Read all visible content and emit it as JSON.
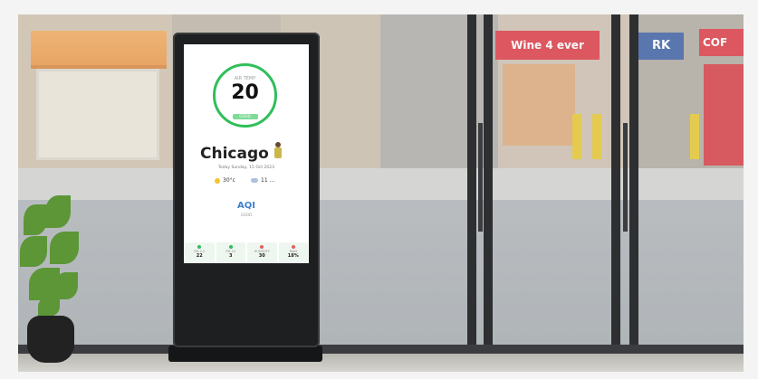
{
  "scene": {
    "signs": {
      "left_store": "Wine 4 ever",
      "blue_sign": "RK",
      "right_store": "COF"
    }
  },
  "kiosk": {
    "ring": {
      "caption": "AIR TEMP",
      "value": "20",
      "status": "GOOD"
    },
    "city": "Chicago",
    "date": "Today Sunday, 15 Oct 2023",
    "weather": [
      {
        "icon": "sun-icon",
        "value": "30°c"
      },
      {
        "icon": "cloud-icon",
        "value": "11 ..."
      }
    ],
    "aqi_label": "AQI",
    "aqi_sub": "GOOD",
    "stats": [
      {
        "label": "PM 2.5",
        "value": "22",
        "color": "#2fbf5a"
      },
      {
        "label": "PM 10",
        "value": "3",
        "color": "#2fbf5a"
      },
      {
        "label": "HUMIDITY",
        "value": "30",
        "color": "#e36060"
      },
      {
        "label": "RAIN",
        "value": "18%",
        "color": "#e36060"
      }
    ],
    "colors": {
      "ring": "#2fbf5a",
      "aqi": "#3d7fcf"
    }
  }
}
